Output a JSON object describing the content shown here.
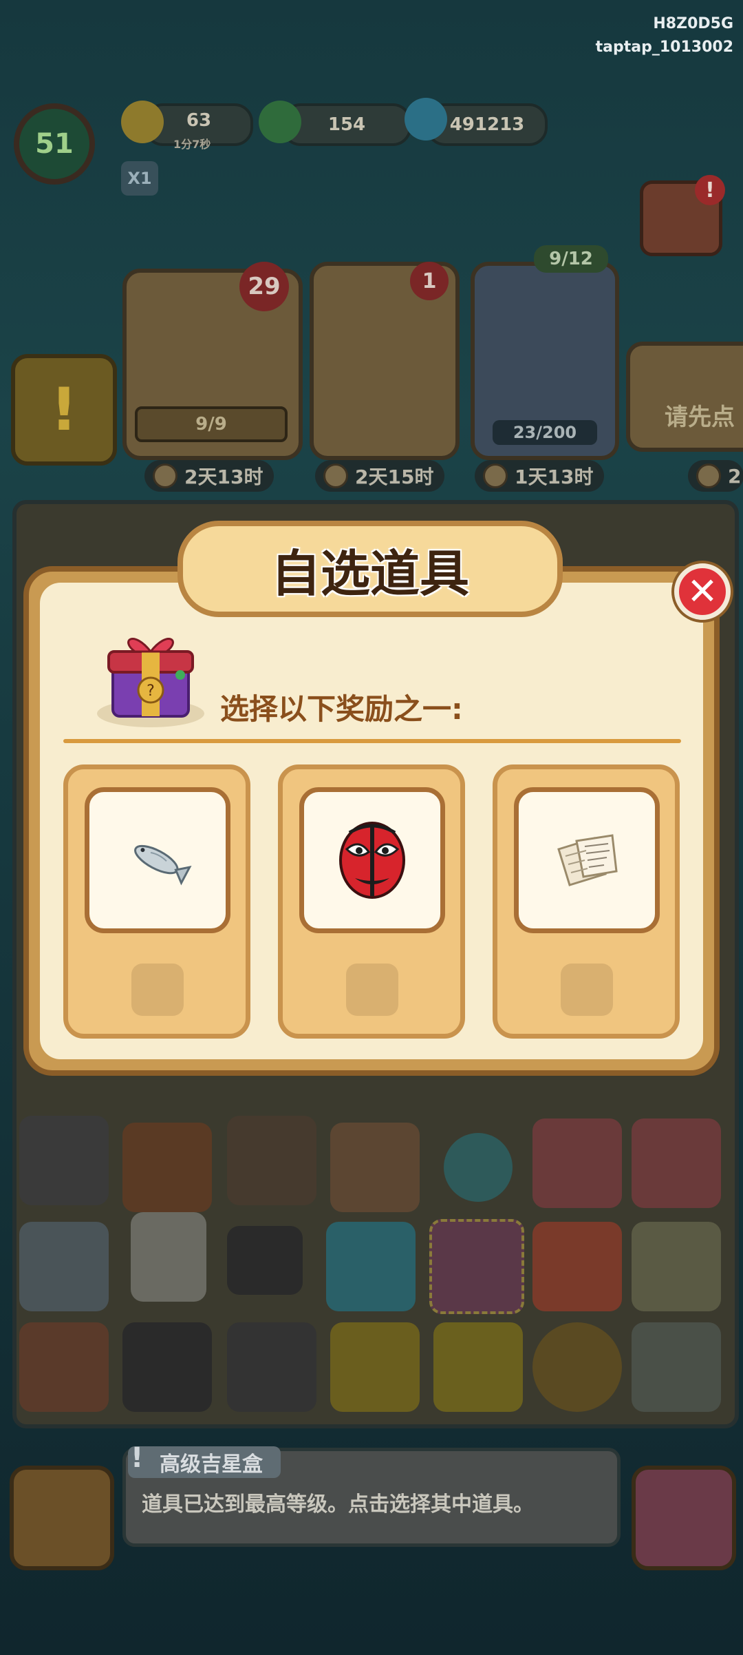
{
  "watermark": {
    "line1": "H8Z0D5G",
    "line2": "taptap_1013002"
  },
  "hud": {
    "level": "51",
    "energy": "63",
    "energy_timer": "1分7秒",
    "multiplier": "X1",
    "coins": "154",
    "gems": "491213"
  },
  "orders": [
    {
      "progress": "9/9",
      "badge": "29",
      "timer": "2天13时"
    },
    {
      "progress": "",
      "badge": "1",
      "timer": "2天15时"
    },
    {
      "progress": "23/200",
      "badge": "9/12",
      "timer": "1天13时"
    },
    {
      "progress": "请先点",
      "badge": "",
      "timer": "2"
    }
  ],
  "modal": {
    "title": "自选道具",
    "prompt": "选择以下奖励之一:",
    "close_glyph": "✕",
    "options": [
      {
        "icon": "fish-icon"
      },
      {
        "icon": "opera-mask-icon"
      },
      {
        "icon": "paper-scroll-icon"
      }
    ]
  },
  "info": {
    "item_name": "高级吉星盒",
    "description": "道具已达到最高等级。点击选择其中道具。"
  },
  "colors": {
    "modal_bg": "#f8edcf",
    "modal_border": "#c99a52",
    "title_text": "#3e2410",
    "prompt_text": "#8a4f1c",
    "close_red": "#e0323a"
  }
}
